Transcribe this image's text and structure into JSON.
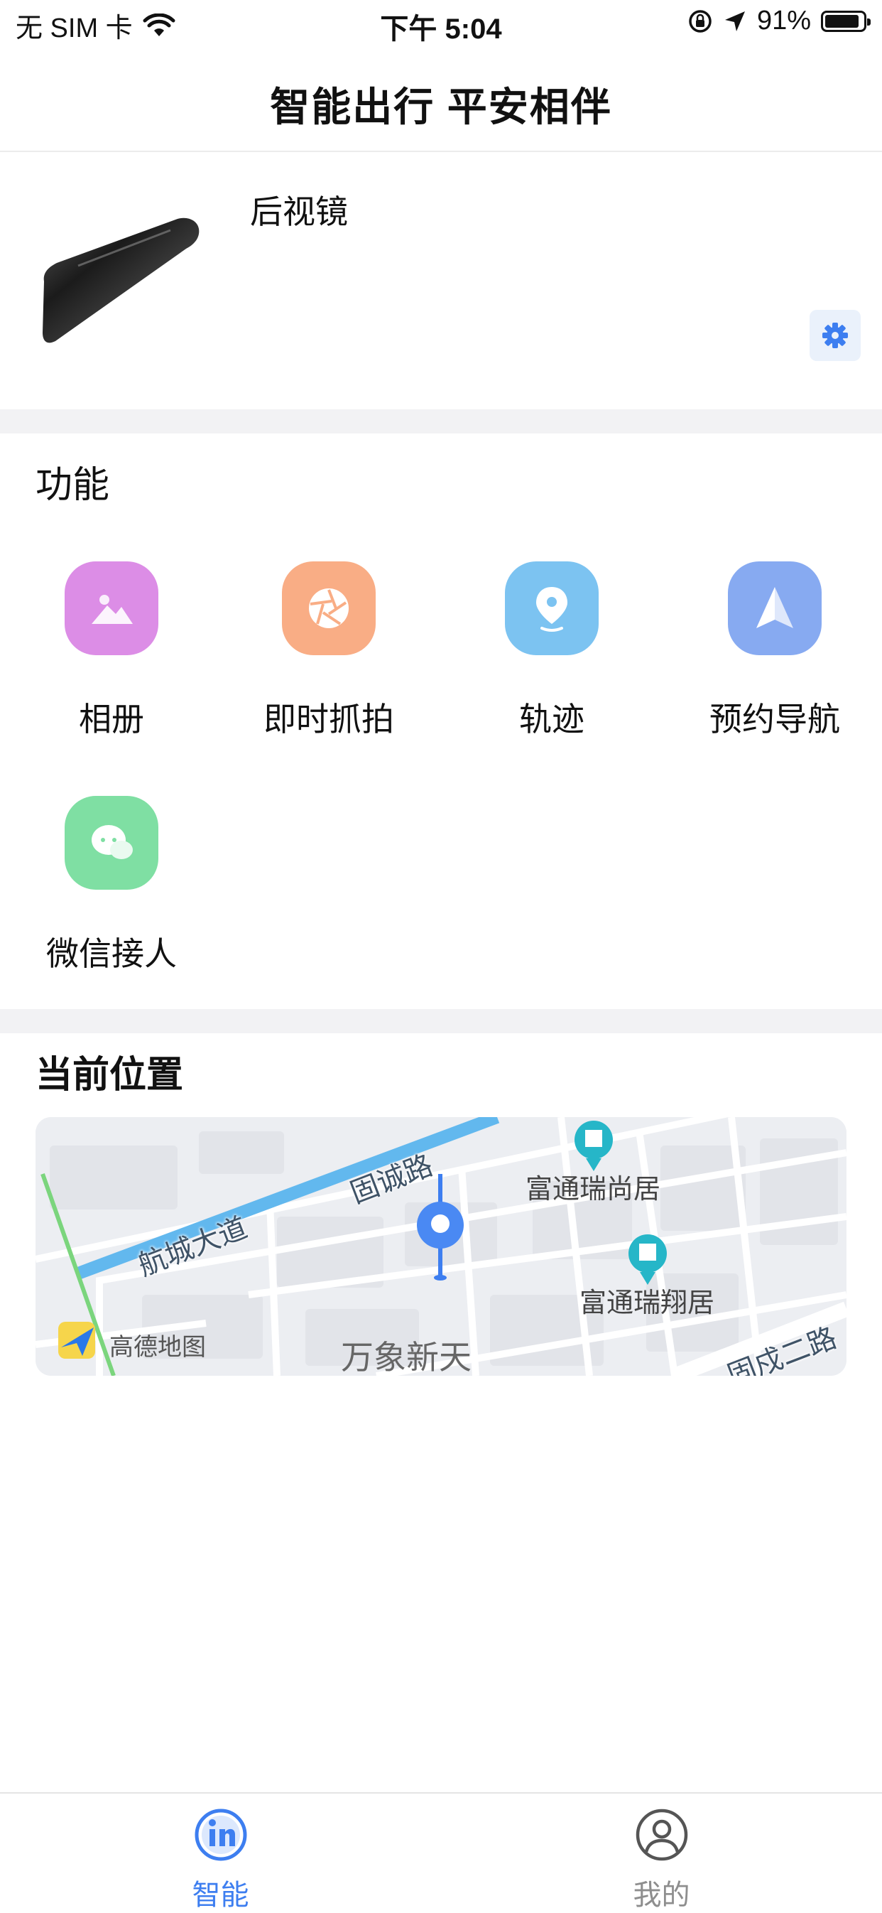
{
  "status_bar": {
    "carrier": "无 SIM 卡",
    "time": "下午 5:04",
    "battery": "91%",
    "battery_level": 0.91
  },
  "header": {
    "title": "智能出行 平安相伴"
  },
  "device": {
    "name": "后视镜",
    "image_icon": "rearview-mirror",
    "settings_icon": "gear-icon"
  },
  "functions": {
    "title": "功能",
    "items": [
      {
        "label": "相册",
        "icon": "photo-album-icon",
        "color": "#dc8de6"
      },
      {
        "label": "即时抓拍",
        "icon": "camera-shutter-icon",
        "color": "#f9ad85"
      },
      {
        "label": "轨迹",
        "icon": "location-pin-icon",
        "color": "#7cc3f1"
      },
      {
        "label": "预约导航",
        "icon": "navigation-arrow-icon",
        "color": "#87aaf1"
      },
      {
        "label": "微信接人",
        "icon": "wechat-chat-icon",
        "color": "#7fdfa3"
      }
    ]
  },
  "location": {
    "title": "当前位置",
    "map": {
      "roads": [
        "航城大道",
        "固诚路",
        "固戍二路"
      ],
      "pois": [
        "富通瑞尚居",
        "富通瑞翔居",
        "万象新天"
      ],
      "provider": "高德地图"
    }
  },
  "tabbar": {
    "tabs": [
      {
        "label": "智能",
        "active": true,
        "color": "#3d7ef0"
      },
      {
        "label": "我的",
        "active": false,
        "color": "#8e8e8e"
      }
    ]
  }
}
